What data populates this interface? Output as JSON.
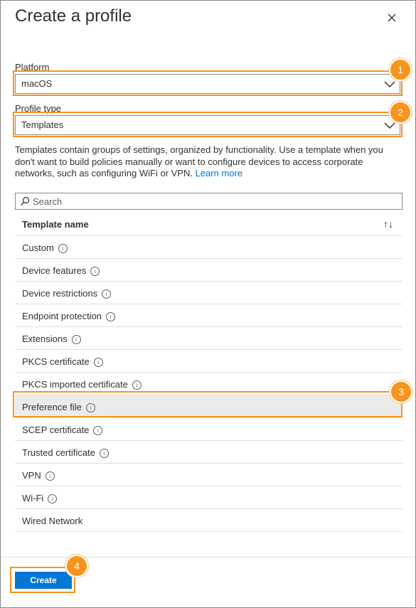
{
  "panel": {
    "title": "Create a profile",
    "close_icon": "close-icon"
  },
  "platform": {
    "label": "Platform",
    "value": "macOS"
  },
  "profile_type": {
    "label": "Profile type",
    "value": "Templates"
  },
  "description": {
    "text": "Templates contain groups of settings, organized by functionality. Use a template when you don't want to build policies manually or want to configure devices to access corporate networks, such as configuring WiFi or VPN.",
    "link": "Learn more"
  },
  "search": {
    "placeholder": "Search",
    "icon": "search-icon"
  },
  "table": {
    "header": "Template name",
    "sort_icon": "↑↓",
    "rows": [
      {
        "name": "Custom",
        "info": true
      },
      {
        "name": "Device features",
        "info": true
      },
      {
        "name": "Device restrictions",
        "info": true
      },
      {
        "name": "Endpoint protection",
        "info": true
      },
      {
        "name": "Extensions",
        "info": true
      },
      {
        "name": "PKCS certificate",
        "info": true
      },
      {
        "name": "PKCS imported certificate",
        "info": true
      },
      {
        "name": "Preference file",
        "info": true,
        "selected": true
      },
      {
        "name": "SCEP certificate",
        "info": true
      },
      {
        "name": "Trusted certificate",
        "info": true
      },
      {
        "name": "VPN",
        "info": true
      },
      {
        "name": "Wi-Fi",
        "info": true
      },
      {
        "name": "Wired Network",
        "info": false
      }
    ]
  },
  "footer": {
    "create_label": "Create"
  },
  "callouts": [
    "1",
    "2",
    "3",
    "4"
  ],
  "colors": {
    "accent": "#0078d4",
    "callout": "#f7941d",
    "selected_row": "#edebe9"
  }
}
